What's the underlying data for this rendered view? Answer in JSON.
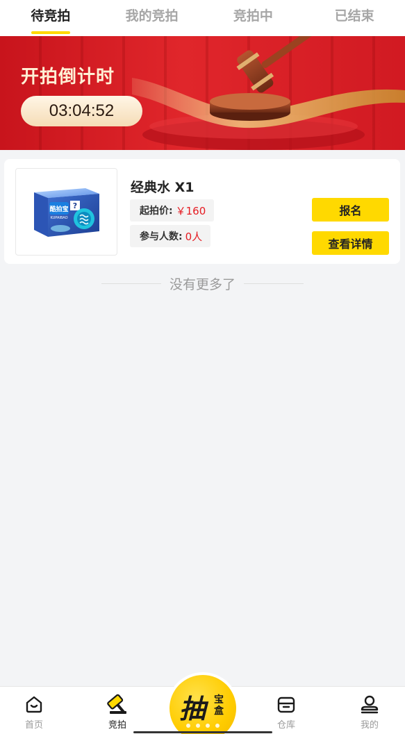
{
  "tabs": [
    {
      "label": "待竞拍",
      "active": true
    },
    {
      "label": "我的竞拍",
      "active": false
    },
    {
      "label": "竞拍中",
      "active": false
    },
    {
      "label": "已结束",
      "active": false
    }
  ],
  "banner": {
    "title": "开拍倒计时",
    "countdown": "03:04:52"
  },
  "item": {
    "title": "经典水 X1",
    "price_label": "起拍价:",
    "price_value": "￥160",
    "people_label": "参与人数:",
    "people_value": "0人",
    "image_brand": "酷拍宝",
    "image_brand_en": "KUPAIBAO",
    "signup_label": "报名",
    "detail_label": "查看详情"
  },
  "list_end_text": "没有更多了",
  "bottom_nav": {
    "items": [
      {
        "label": "首页",
        "icon": "home-icon",
        "active": false
      },
      {
        "label": "竞拍",
        "icon": "gavel-icon",
        "active": true
      },
      {
        "label": "仓库",
        "icon": "box-icon",
        "active": false
      },
      {
        "label": "我的",
        "icon": "user-icon",
        "active": false
      }
    ],
    "center_main": "抽",
    "center_sub": "宝盒"
  },
  "colors": {
    "accent": "#ffd900",
    "banner_red": "#d11a22",
    "price_red": "#e51c23"
  }
}
